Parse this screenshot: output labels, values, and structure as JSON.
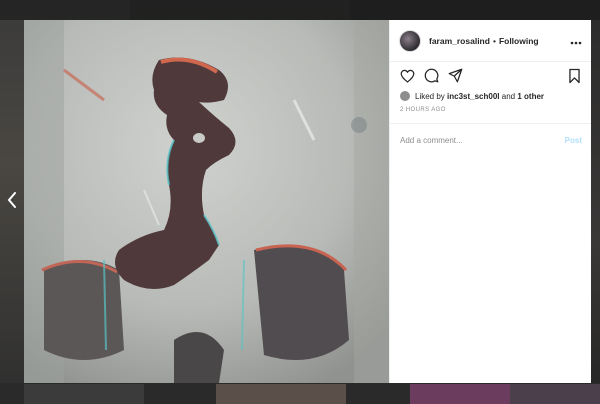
{
  "post": {
    "username": "faram_rosalind",
    "separator": "•",
    "follow_status": "Following",
    "liked_prefix": "Liked by",
    "liked_user": "inc3st_sch00l",
    "liked_and": "and",
    "liked_others": "1 other",
    "time_ago": "2 HOURS AGO",
    "comment_placeholder": "Add a comment...",
    "post_label": "Post"
  },
  "icons": {
    "prev": "chevron-left-icon",
    "more": "more-options-icon",
    "like": "heart-icon",
    "comment": "comment-icon",
    "share": "share-icon",
    "save": "bookmark-icon"
  },
  "colors": {
    "text": "#262626",
    "muted": "#8e8e8e",
    "post_button_disabled": "#b2dffc",
    "border": "#efefef"
  }
}
